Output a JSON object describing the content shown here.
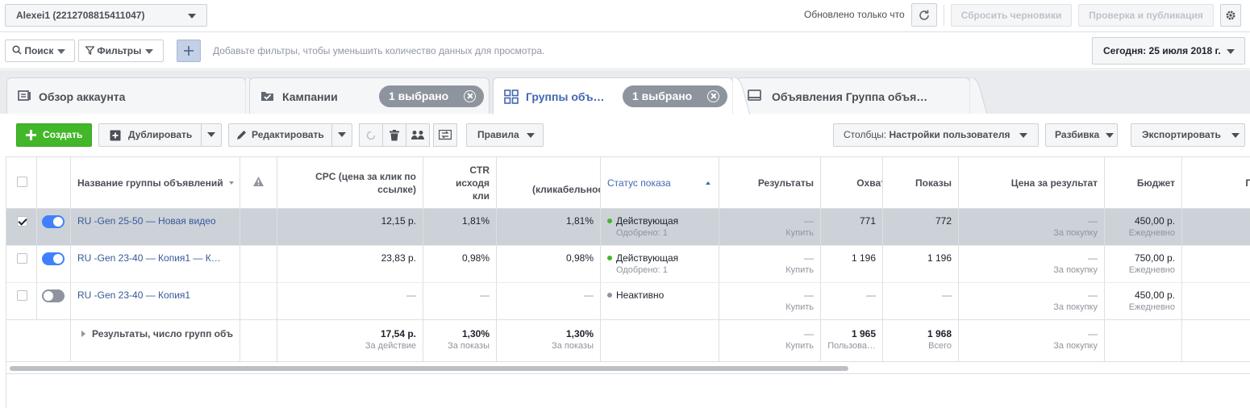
{
  "topbar": {
    "account": "Alexei1 (2212708815411047)",
    "updated_text": "Обновлено только что",
    "discard_drafts": "Сбросить черновики",
    "review_publish": "Проверка и публикация"
  },
  "filterbar": {
    "search_label": "Поиск",
    "filters_label": "Фильтры",
    "hint": "Добавьте фильтры, чтобы уменьшить количество данных для просмотра.",
    "date_label": "Сегодня: 25 июля 2018 г."
  },
  "tabs": [
    {
      "label": "Обзор аккаунта",
      "icon": "account-overview-icon"
    },
    {
      "label": "Кампании",
      "icon": "campaign-check-icon",
      "selected": "1 выбрано"
    },
    {
      "label": "Группы объ…",
      "icon": "ad-sets-grid-icon",
      "selected": "1 выбрано",
      "active": true
    },
    {
      "label": "Объявления Группа объя…",
      "icon": "ads-icon"
    }
  ],
  "toolbar": {
    "create": "Создать",
    "duplicate": "Дублировать",
    "edit": "Редактировать",
    "rules": "Правила",
    "columns_prefix": "Столбцы: ",
    "columns_value": "Настройки пользователя",
    "breakdown": "Разбивка",
    "export": "Экспортировать"
  },
  "table": {
    "headers": {
      "name": "Название группы объявлений",
      "cpc": "CPC (цена за клик по ссылке)",
      "ctr_line1": "CTR",
      "ctr_line2": "исходя",
      "ctr_line3": "кли",
      "cpm_line1": "(",
      "cpm_line2": "(кликабельнос",
      "status": "Статус показа",
      "results": "Результаты",
      "reach": "Охват",
      "impressions": "Показы",
      "cost_per_result": "Цена за результат",
      "budget": "Бюджет",
      "next": "П"
    },
    "rows": [
      {
        "name": "RU -Gen 25-50 — Новая видео",
        "cpc": "12,15 р.",
        "ctr": "1,81%",
        "cpm": "1,81%",
        "status": "Действующая",
        "status_sub": "Одобрено: 1",
        "results": "—",
        "results_sub": "Купить",
        "reach": "771",
        "impressions": "772",
        "cost": "—",
        "cost_sub": "За покупку",
        "budget": "450,00 р.",
        "budget_sub": "Ежедневно"
      },
      {
        "name": "RU -Gen 23-40 — Копия1 — К…",
        "cpc": "23,83 р.",
        "ctr": "0,98%",
        "cpm": "0,98%",
        "status": "Действующая",
        "status_sub": "Одобрено: 1",
        "results": "—",
        "results_sub": "Купить",
        "reach": "1 196",
        "impressions": "1 196",
        "cost": "—",
        "cost_sub": "За покупку",
        "budget": "750,00 р.",
        "budget_sub": "Ежедневно"
      },
      {
        "name": "RU -Gen 23-40 — Копия1",
        "cpc": "—",
        "ctr": "—",
        "cpm": "—",
        "status": "Неактивно",
        "results": "—",
        "results_sub": "Купить",
        "reach": "—",
        "impressions": "—",
        "cost": "—",
        "cost_sub": "За покупку",
        "budget": "450,00 р.",
        "budget_sub": "Ежедневно"
      }
    ],
    "totals": {
      "label": "Результаты, число групп объ",
      "cpc": "17,54 р.",
      "cpc_sub": "За действие",
      "ctr": "1,30%",
      "ctr_sub": "За показы",
      "cpm": "1,30%",
      "cpm_sub": "За показы",
      "results": "—",
      "results_sub": "Купить",
      "reach": "1 965",
      "reach_sub": "Пользова…",
      "impressions": "1 968",
      "impressions_sub": "Всего",
      "cost": "—",
      "cost_sub": "За покупку"
    }
  },
  "colors": {
    "accent": "#4267b2",
    "link": "#365899",
    "green": "#42b72a",
    "toggle_on": "#4080ff",
    "status_active": "#42b72a",
    "status_inactive": "#8d949e",
    "selected_row": "#cdd2d9"
  }
}
